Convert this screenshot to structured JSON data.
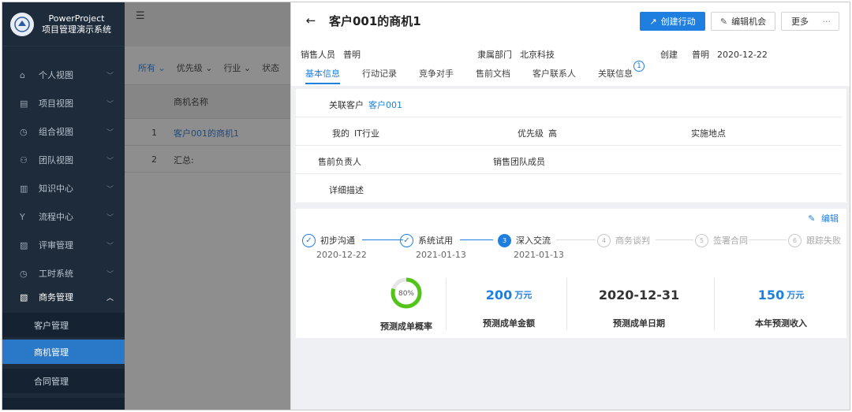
{
  "sidebar": {
    "app_name_line1": "PowerProject",
    "app_name_line2": "项目管理演示系统",
    "items": [
      {
        "label": "个人视图",
        "icon": "home-icon"
      },
      {
        "label": "项目视图",
        "icon": "calendar-icon"
      },
      {
        "label": "组合视图",
        "icon": "clock-icon"
      },
      {
        "label": "团队视图",
        "icon": "team-icon"
      },
      {
        "label": "知识中心",
        "icon": "book-icon"
      },
      {
        "label": "流程中心",
        "icon": "flow-icon"
      },
      {
        "label": "评审管理",
        "icon": "review-icon"
      },
      {
        "label": "工时系统",
        "icon": "clock-icon"
      },
      {
        "label": "商务管理",
        "icon": "document-icon"
      }
    ],
    "sub_items": [
      {
        "label": "客户管理"
      },
      {
        "label": "商机管理"
      },
      {
        "label": "合同管理"
      }
    ]
  },
  "list": {
    "filters": [
      "所有",
      "优先级",
      "行业",
      "状态"
    ],
    "column_header": "商机名称",
    "rows": [
      {
        "no": "1",
        "name": "客户001的商机1"
      },
      {
        "no": "2",
        "name": "汇总:"
      }
    ]
  },
  "detail": {
    "title": "客户001的商机1",
    "actions": {
      "create_action": "创建行动",
      "edit": "编辑机会",
      "more": "更多",
      "more_dots": "···"
    },
    "meta": {
      "salesperson_label": "销售人员",
      "salesperson": "普明",
      "department_label": "隶属部门",
      "department": "北京科技",
      "created_label": "创建",
      "created_by": "普明",
      "created_date": "2020-12-22"
    },
    "tabs": [
      "基本信息",
      "行动记录",
      "竞争对手",
      "售前文档",
      "客户联系人",
      "关联信息"
    ],
    "tab_badge": "1",
    "info": {
      "related_customer_label": "关联客户",
      "related_customer": "客户001",
      "mine_label": "我的",
      "mine_value": "IT行业",
      "priority_label": "优先级",
      "priority_value": "高",
      "location_label": "实施地点",
      "presales_label": "售前负责人",
      "team_label": "销售团队成员",
      "description_label": "详细描述"
    },
    "edit_label": "编辑",
    "steps": [
      {
        "num": "✓",
        "name": "初步沟通",
        "date": "2020-12-22",
        "state": "done"
      },
      {
        "num": "✓",
        "name": "系统试用",
        "date": "2021-01-13",
        "state": "done"
      },
      {
        "num": "3",
        "name": "深入交流",
        "date": "2021-01-13",
        "state": "current"
      },
      {
        "num": "4",
        "name": "商务谈判",
        "date": "",
        "state": "todo"
      },
      {
        "num": "5",
        "name": "签署合同",
        "date": "",
        "state": "todo"
      },
      {
        "num": "6",
        "name": "跟踪失败",
        "date": "",
        "state": "todo"
      }
    ],
    "stats": {
      "probability": 0.8,
      "probability_text": "80%",
      "probability_label": "预测成单概率",
      "amount": "200",
      "amount_unit": "万元",
      "amount_label": "预测成单金额",
      "date": "2020-12-31",
      "date_label": "预测成单日期",
      "annual": "150",
      "annual_unit": "万元",
      "annual_label": "本年预测收入"
    }
  },
  "colors": {
    "accent": "#1e7fe0",
    "sidebar_bg": "#1d2b3a",
    "sidebar_active": "#2a79c8",
    "ring": "#52c41a"
  }
}
